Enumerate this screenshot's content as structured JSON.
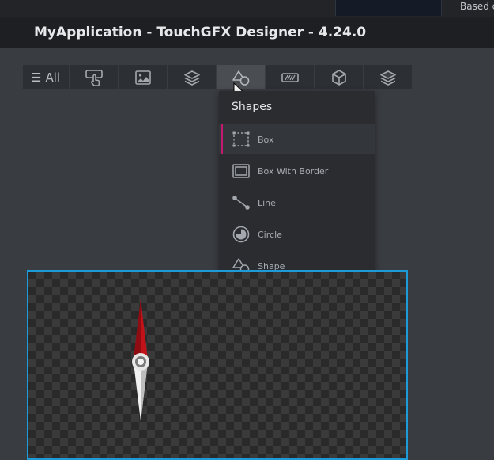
{
  "background_window": {
    "partial_text": "Based c"
  },
  "titlebar": {
    "title": "MyApplication - TouchGFX Designer - 4.24.0"
  },
  "toolbar": {
    "all_label": "All",
    "buttons": [
      {
        "icon": "hand-pointer-icon"
      },
      {
        "icon": "image-icon"
      },
      {
        "icon": "layers-icon"
      },
      {
        "icon": "shapes-icon",
        "active": true
      },
      {
        "icon": "progress-icon"
      },
      {
        "icon": "cube-icon"
      },
      {
        "icon": "stack-icon"
      }
    ]
  },
  "dropdown": {
    "title": "Shapes",
    "items": [
      {
        "label": "Box",
        "icon": "box-icon",
        "selected": true
      },
      {
        "label": "Box With Border",
        "icon": "box-with-border-icon"
      },
      {
        "label": "Line",
        "icon": "line-icon"
      },
      {
        "label": "Circle",
        "icon": "circle-icon"
      },
      {
        "label": "Shape",
        "icon": "shape-icon"
      }
    ]
  },
  "colors": {
    "accent": "#c2186e",
    "canvas_border": "#1d9bd8",
    "needle_red": "#c1121a",
    "needle_white": "#f2f2f2"
  }
}
